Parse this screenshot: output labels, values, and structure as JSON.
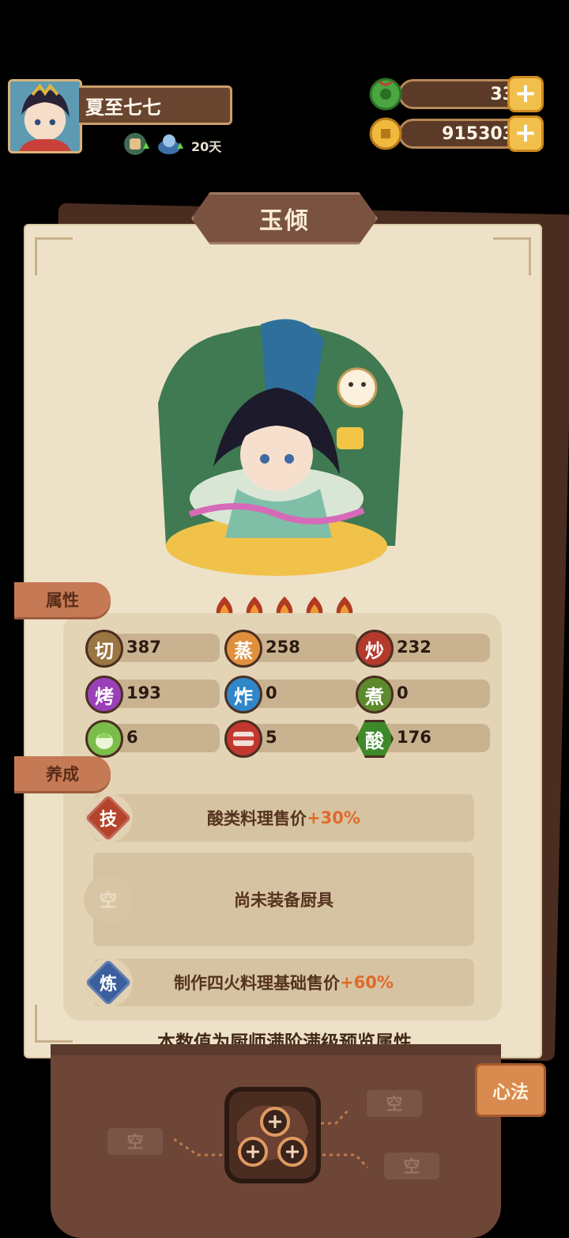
{
  "player": {
    "name": "夏至七七",
    "days_label": "20天"
  },
  "currencies": {
    "jade": "33",
    "coins": "915303",
    "plus_label": "+"
  },
  "chef": {
    "name": "玉倾",
    "stars": 5,
    "section_attr": "属性",
    "section_train": "养成",
    "stats": [
      {
        "icon_char": "切",
        "value": "387",
        "color": "#9a7643"
      },
      {
        "icon_char": "蒸",
        "value": "258",
        "color": "#e0903d"
      },
      {
        "icon_char": "炒",
        "value": "232",
        "color": "#b33a2c"
      },
      {
        "icon_char": "烤",
        "value": "193",
        "color": "#9a3fb8"
      },
      {
        "icon_char": "炸",
        "value": "0",
        "color": "#2f86c9"
      },
      {
        "icon_char": "煮",
        "value": "0",
        "color": "#5d8a2d"
      },
      {
        "icon_char": "",
        "value": "6",
        "color": "#7bbd4a",
        "icon": "cabbage-icon"
      },
      {
        "icon_char": "",
        "value": "5",
        "color": "#c2382e",
        "icon": "meat-icon"
      },
      {
        "icon_char": "酸",
        "value": "176",
        "color": "#3e8a2a"
      }
    ],
    "skill": {
      "badge": "技",
      "text": "酸类料理售价",
      "bonus": "+30%"
    },
    "equip": {
      "badge": "空",
      "text": "尚未装备厨具"
    },
    "refine": {
      "badge": "炼",
      "text": "制作四火料理基础售价",
      "bonus": "+60%"
    },
    "note": "本数值为厨师满阶满级预览属性"
  },
  "xinfa": {
    "button_label": "心法",
    "slots": [
      "空",
      "空",
      "空"
    ]
  },
  "colors": {
    "panel": "#ede2c7",
    "accent_orange": "#e06a2a",
    "frame_brown": "#6d4637"
  }
}
